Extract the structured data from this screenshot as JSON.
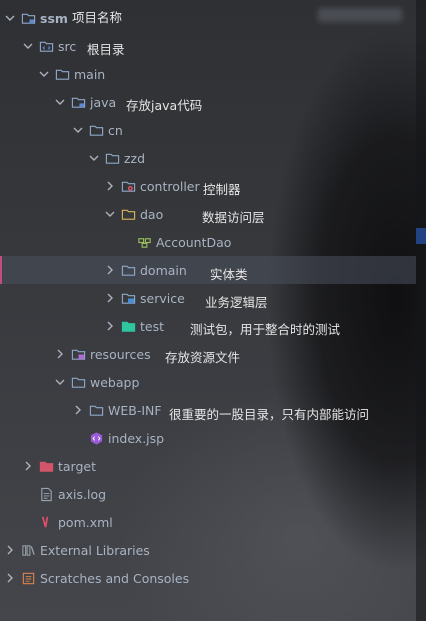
{
  "tree": {
    "root": "ssm",
    "src": "src",
    "main": "main",
    "java": "java",
    "cn": "cn",
    "zzd": "zzd",
    "controller": "controller",
    "dao": "dao",
    "accountdao": "AccountDao",
    "domain": "domain",
    "service": "service",
    "test": "test",
    "resources": "resources",
    "webapp": "webapp",
    "webinf": "WEB-INF",
    "indexjsp": "index.jsp",
    "target": "target",
    "axislog": "axis.log",
    "pomxml": "pom.xml",
    "extlibs": "External Libraries",
    "scratches": "Scratches and Consoles"
  },
  "annotations": {
    "root": "项目名称",
    "src": "根目录",
    "java": "存放java代码",
    "controller": "控制器",
    "dao": "数据访问层",
    "domain": "实体类",
    "service": "业务逻辑层",
    "test": "测试包，用于整合时的测试",
    "resources": "存放资源文件",
    "webinf": "很重要的一股目录，只有内部能访问"
  },
  "colors": {
    "folder": "#8fa8c8",
    "selected_marker": "#c24e7a",
    "target_folder": "#d4556b",
    "test_folder": "#2fc6a0"
  }
}
